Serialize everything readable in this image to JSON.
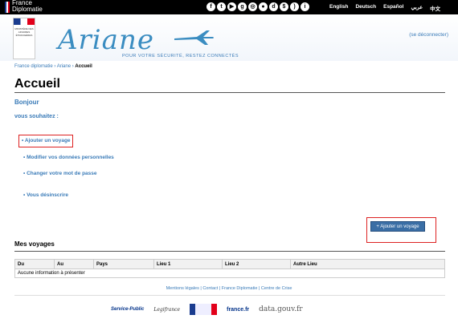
{
  "topbar": {
    "logo_line1": "France",
    "logo_line2": "Diplomatie",
    "social_icons": [
      "facebook-icon",
      "twitter-icon",
      "youtube-icon",
      "googleplus-icon",
      "instagram-icon",
      "flickr-icon",
      "dailymotion-icon",
      "rss-icon",
      "link-icon"
    ],
    "languages": [
      "English",
      "Deutsch",
      "Español",
      "عربي",
      "中文"
    ]
  },
  "header": {
    "marianne_text": "MINISTÈRE DES AFFAIRES ÉTRANGÈRES",
    "app_name": "Ariane",
    "slogan": "POUR VOTRE SÉCURITÉ, RESTEZ CONNECTÉS",
    "logout": "(se déconnecter)"
  },
  "breadcrumb": [
    "France diplomatie",
    "Ariane",
    "Accueil"
  ],
  "page": {
    "title": "Accueil",
    "greeting": "Bonjour",
    "wish_label": "vous souhaitez :"
  },
  "menu": {
    "add_trip": "• Ajouter un voyage",
    "edit_personal": "• Modifier vos données personnelles",
    "change_password": "• Changer votre mot de passe",
    "unsubscribe": "• Vous désinscrire"
  },
  "add_button": "+ Ajouter un voyage",
  "trips": {
    "title": "Mes voyages",
    "columns": [
      "Du",
      "Au",
      "Pays",
      "Lieu 1",
      "Lieu 2",
      "Autre Lieu"
    ],
    "empty": "Aucune information à présenter"
  },
  "footer": {
    "links": "Mentions légales | Contact | France Diplomatie | Centre de Crise",
    "logo_service_public": "Service-Public",
    "logo_legifrance": "Legifrance",
    "logo_france": "france.fr",
    "logo_datagouv": "data.gouv.fr"
  }
}
